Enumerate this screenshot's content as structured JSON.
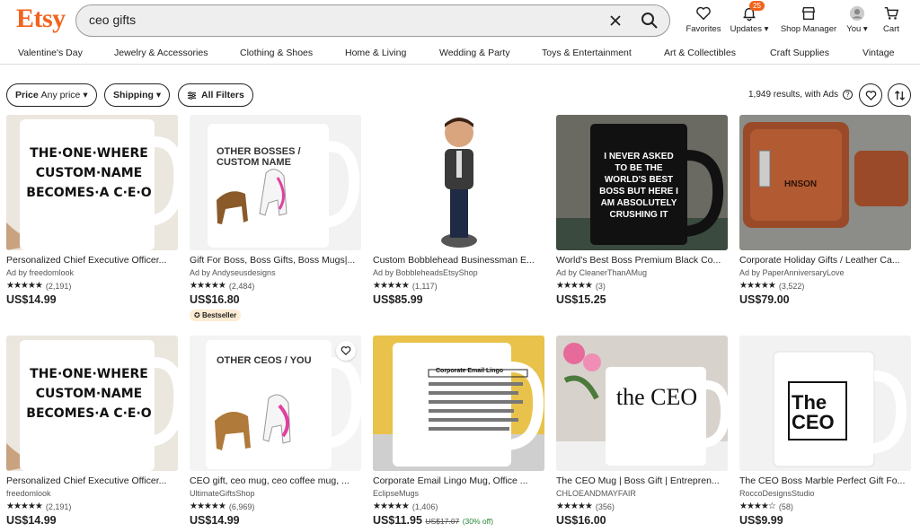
{
  "header": {
    "logo": "Etsy",
    "search_value": "ceo gifts",
    "nav": [
      {
        "label": "Favorites",
        "icon": "heart-icon"
      },
      {
        "label": "Updates ▾",
        "icon": "bell-icon",
        "badge": "25"
      },
      {
        "label": "Shop Manager",
        "icon": "shop-icon"
      },
      {
        "label": "You ▾",
        "icon": "avatar-icon"
      },
      {
        "label": "Cart",
        "icon": "cart-icon"
      }
    ]
  },
  "categories": [
    "Valentine's Day",
    "Jewelry & Accessories",
    "Clothing & Shoes",
    "Home & Living",
    "Wedding & Party",
    "Toys & Entertainment",
    "Art & Collectibles",
    "Craft Supplies",
    "Vintage"
  ],
  "filters": {
    "price_label": "Price",
    "price_value": "Any price",
    "shipping_label": "Shipping",
    "all_filters_label": "All Filters",
    "results_text": "1,949 results, with Ads"
  },
  "colors": {
    "accent": "#F1641E",
    "discount": "#258635"
  },
  "products": [
    {
      "title": "Personalized Chief Executive Officer...",
      "shop": "Ad by freedomlook",
      "stars": "★★★★★",
      "reviews": "(2,191)",
      "price": "US$14.99",
      "image_text": "THE·ONE·WHERE CUSTOM·NAME BECOMES·A C·E·O"
    },
    {
      "title": "Gift For Boss, Boss Gifts, Boss Mugs|...",
      "shop": "Ad by Andyseusdesigns",
      "stars": "★★★★★",
      "reviews": "(2,484)",
      "price": "US$16.80",
      "badge": "Bestseller",
      "image_text": "OTHER BOSSES / CUSTOM NAME"
    },
    {
      "title": "Custom Bobblehead Businessman E...",
      "shop": "Ad by BobbleheadsEtsyShop",
      "stars": "★★★★★",
      "reviews": "(1,117)",
      "price": "US$85.99",
      "image_text": ""
    },
    {
      "title": "World's Best Boss Premium Black Co...",
      "shop": "Ad by CleanerThanAMug",
      "stars": "★★★★★",
      "reviews": "(3)",
      "price": "US$15.25",
      "image_text": "I NEVER ASKED TO BE THE WORLD'S BEST BOSS BUT HERE I AM ABSOLUTELY CRUSHING IT"
    },
    {
      "title": "Corporate Holiday Gifts / Leather Ca...",
      "shop": "Ad by PaperAnniversaryLove",
      "stars": "★★★★★",
      "reviews": "(3,522)",
      "price": "US$79.00",
      "image_text": "HNSON"
    },
    {
      "title": "Personalized Chief Executive Officer...",
      "shop": "freedomlook",
      "stars": "★★★★★",
      "reviews": "(2,191)",
      "price": "US$14.99",
      "image_text": "THE·ONE·WHERE CUSTOM·NAME BECOMES·A C·E·O"
    },
    {
      "title": "CEO gift, ceo mug, ceo coffee mug, ...",
      "shop": "UltimateGiftsShop",
      "stars": "★★★★★",
      "reviews": "(6,969)",
      "price": "US$14.99",
      "image_text": "OTHER CEOS / YOU"
    },
    {
      "title": "Corporate Email Lingo Mug, Office ...",
      "shop": "EclipseMugs",
      "stars": "★★★★★",
      "reviews": "(1,406)",
      "price": "US$11.95",
      "orig": "US$17.07",
      "disc": "(30% off)",
      "image_text": "Corporate Email Lingo"
    },
    {
      "title": "The CEO Mug | Boss Gift | Entrepren...",
      "shop": "CHLOEANDMAYFAIR",
      "stars": "★★★★★",
      "reviews": "(356)",
      "price": "US$16.00",
      "image_text": "the CEO"
    },
    {
      "title": "The CEO Boss Marble Perfect Gift Fo...",
      "shop": "RoccoDesignsStudio",
      "stars": "★★★★☆",
      "reviews": "(58)",
      "price": "US$9.99",
      "image_text": "The CEO"
    }
  ]
}
